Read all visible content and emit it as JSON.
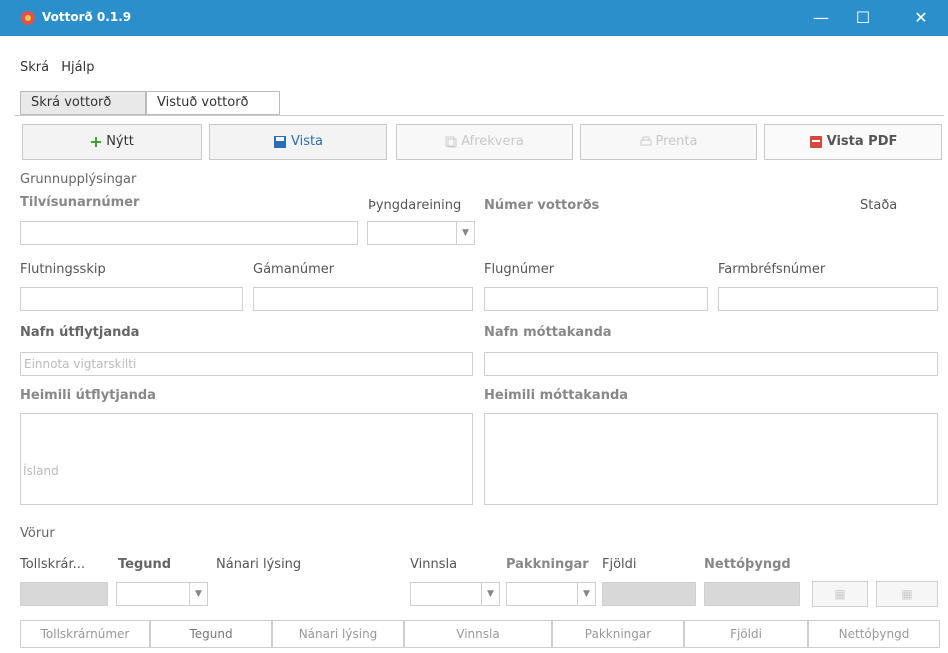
{
  "window": {
    "title": "Vottorð 0.1.9",
    "minimize": "—",
    "maximize": "☐",
    "close": "✕",
    "titlebar_color": "#2b8fcb"
  },
  "menu": {
    "items": [
      "Skrá",
      "Hjálp"
    ]
  },
  "tabs": [
    {
      "label": "Skrá vottorð",
      "active": true
    },
    {
      "label": "Vistuð vottorð",
      "active": false
    }
  ],
  "toolbar": {
    "new": {
      "label": "Nýtt",
      "icon": "plus-icon"
    },
    "save": {
      "label": "Vista",
      "icon": "save-icon"
    },
    "btn3": {
      "label": "Afrekvera",
      "icon": "copy-icon"
    },
    "print": {
      "label": "Prenta",
      "icon": "print-icon"
    },
    "pdf": {
      "label": "Vista PDF",
      "icon": "pdf-icon"
    }
  },
  "basic": {
    "section": "Grunnupplýsingar",
    "id_number": "Tilvísunarnúmer",
    "weight_unit": "Þyngdareining",
    "cert_number": "Númer vottorðs",
    "status": "Staða",
    "ship": "Flutningsskip",
    "container": "Gámanúmer",
    "flight": "Flugnúmer",
    "bill": "Farmbréfsnúmer",
    "exporter_name": "Nafn útflytjanda",
    "exporter_placeholder": "Einnota vigtarskilti",
    "receiver_name": "Nafn móttakanda",
    "exporter_address": "Heimili útflytjanda",
    "exporter_address_placeholder": "Ísland",
    "receiver_address": "Heimili móttakanda"
  },
  "goods": {
    "section": "Vörur",
    "labels": {
      "tariff": "Tollskrár...",
      "type": "Tegund",
      "description": "Nánari lýsing",
      "processing": "Vinnsla",
      "packaging": "Pakkningar",
      "count": "Fjöldi",
      "net_weight": "Nettóþyngd"
    },
    "add_icon": "add-row-icon",
    "delete_icon": "delete-row-icon"
  },
  "table": {
    "columns": [
      "Tollskrárnúmer",
      "Tegund",
      "Nánari lýsing",
      "Vinnsla",
      "Pakkningar",
      "Fjöldi",
      "Nettóþyngd"
    ]
  }
}
